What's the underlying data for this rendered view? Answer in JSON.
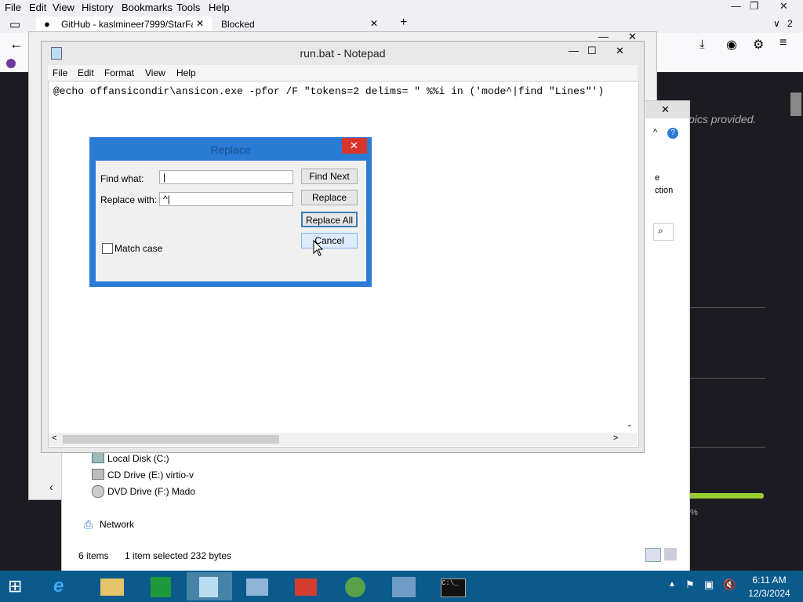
{
  "firefox": {
    "menu": [
      "File",
      "Edit",
      "View",
      "History",
      "Bookmarks",
      "Tools",
      "Help"
    ],
    "tabs": [
      {
        "label": "GitHub - kaslmineer7999/StarFa"
      },
      {
        "label": "Blocked"
      }
    ],
    "new_tab": "+",
    "tab_count": "2",
    "page_text": "pics provided."
  },
  "explorer": {
    "drives": [
      {
        "label": "Local Disk (C:)"
      },
      {
        "label": "CD Drive (E:) virtio-v"
      },
      {
        "label": "DVD Drive (F:) Mado"
      }
    ],
    "network": "Network",
    "status_items": "6 items",
    "status_selected": "1 item selected",
    "status_size": "232 bytes",
    "side_text_1": "e",
    "side_text_2": "ction"
  },
  "notepad": {
    "title": "run.bat - Notepad",
    "menu": [
      "File",
      "Edit",
      "Format",
      "View",
      "Help"
    ],
    "content": "@echo offansicondir\\ansicon.exe -pfor /F \"tokens=2 delims= \" %%i in ('mode^|find \"Lines\"')"
  },
  "replace_dialog": {
    "title": "Replace",
    "find_label": "Find what:",
    "find_value": "|",
    "replace_label": "Replace with:",
    "replace_value": "^|",
    "find_next": "Find Next",
    "replace": "Replace",
    "replace_all": "Replace All",
    "cancel": "Cancel",
    "match_case": "Match case",
    "close": "✕"
  },
  "taskbar": {
    "time": "6:11 AM",
    "date": "12/3/2024"
  },
  "misc": {
    "percent": "%"
  }
}
